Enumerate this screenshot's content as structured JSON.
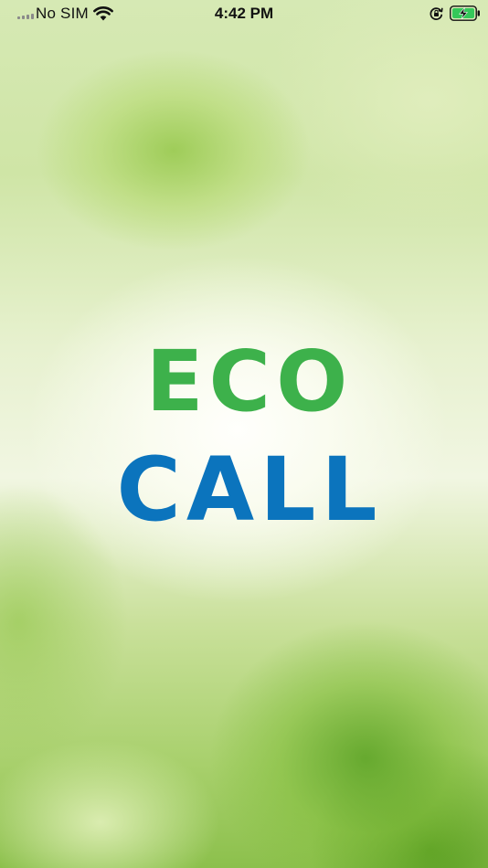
{
  "status_bar": {
    "carrier": "No SIM",
    "time": "4:42 PM",
    "signal_icon": "signal-bars-icon",
    "wifi_icon": "wifi-icon",
    "rotation_lock_icon": "rotation-lock-icon",
    "battery_icon": "battery-charging-icon",
    "battery_color": "#34c759"
  },
  "splash": {
    "logo_line1": "ECO",
    "logo_line2": "CALL",
    "logo_line1_color": "#3db14b",
    "logo_line2_color": "#0b74bd"
  }
}
